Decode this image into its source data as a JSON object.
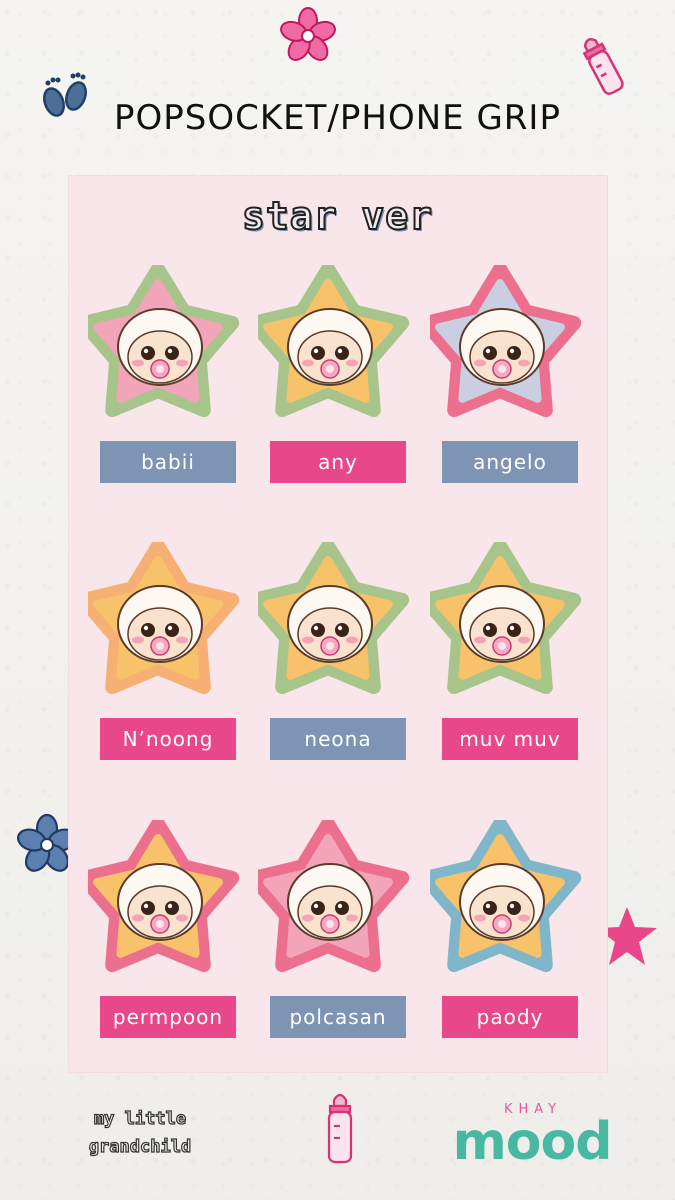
{
  "header": {
    "title": "POPSOCKET/PHONE GRIP"
  },
  "panel": {
    "subtitle": "star ver"
  },
  "items": [
    {
      "name": "babii",
      "label_color": "#7d94b3",
      "star_outer": "#a7c48a",
      "star_inner": "#f2a5b8",
      "character": "green-dino-hood-icon"
    },
    {
      "name": "any",
      "label_color": "#e8488a",
      "star_outer": "#a7c48a",
      "star_inner": "#f8c26a",
      "character": "white-bunny-hood-icon"
    },
    {
      "name": "angelo",
      "label_color": "#7d94b3",
      "star_outer": "#ec6f8d",
      "star_inner": "#c9cfe0",
      "character": "crown-hood-icon"
    },
    {
      "name": "N’noong",
      "label_color": "#e8488a",
      "star_outer": "#f6b073",
      "star_inner": "#f8c26a",
      "character": "crab-hood-icon"
    },
    {
      "name": "neona",
      "label_color": "#7d94b3",
      "star_outer": "#a7c48a",
      "star_inner": "#f8c26a",
      "character": "pink-hair-icon"
    },
    {
      "name": "muv muv",
      "label_color": "#e8488a",
      "star_outer": "#a7c48a",
      "star_inner": "#f8c26a",
      "character": "orange-cat-hood-icon"
    },
    {
      "name": "permpoon",
      "label_color": "#e8488a",
      "star_outer": "#ec6f8d",
      "star_inner": "#f8c26a",
      "character": "teal-bear-icon"
    },
    {
      "name": "polcasan",
      "label_color": "#7d94b3",
      "star_outer": "#ec6f8d",
      "star_inner": "#f2a5b8",
      "character": "orca-hood-icon"
    },
    {
      "name": "paody",
      "label_color": "#e8488a",
      "star_outer": "#7fb6c9",
      "star_inner": "#f8c26a",
      "character": "dumpling-hood-icon"
    }
  ],
  "footer": {
    "brand_line1": "my little",
    "brand_line2": "grandchild",
    "logo_small": "KHAY",
    "logo_main": "mood"
  },
  "colors": {
    "panel": "#f8e6ea",
    "pink": "#e8488a",
    "blue": "#7d94b3"
  }
}
